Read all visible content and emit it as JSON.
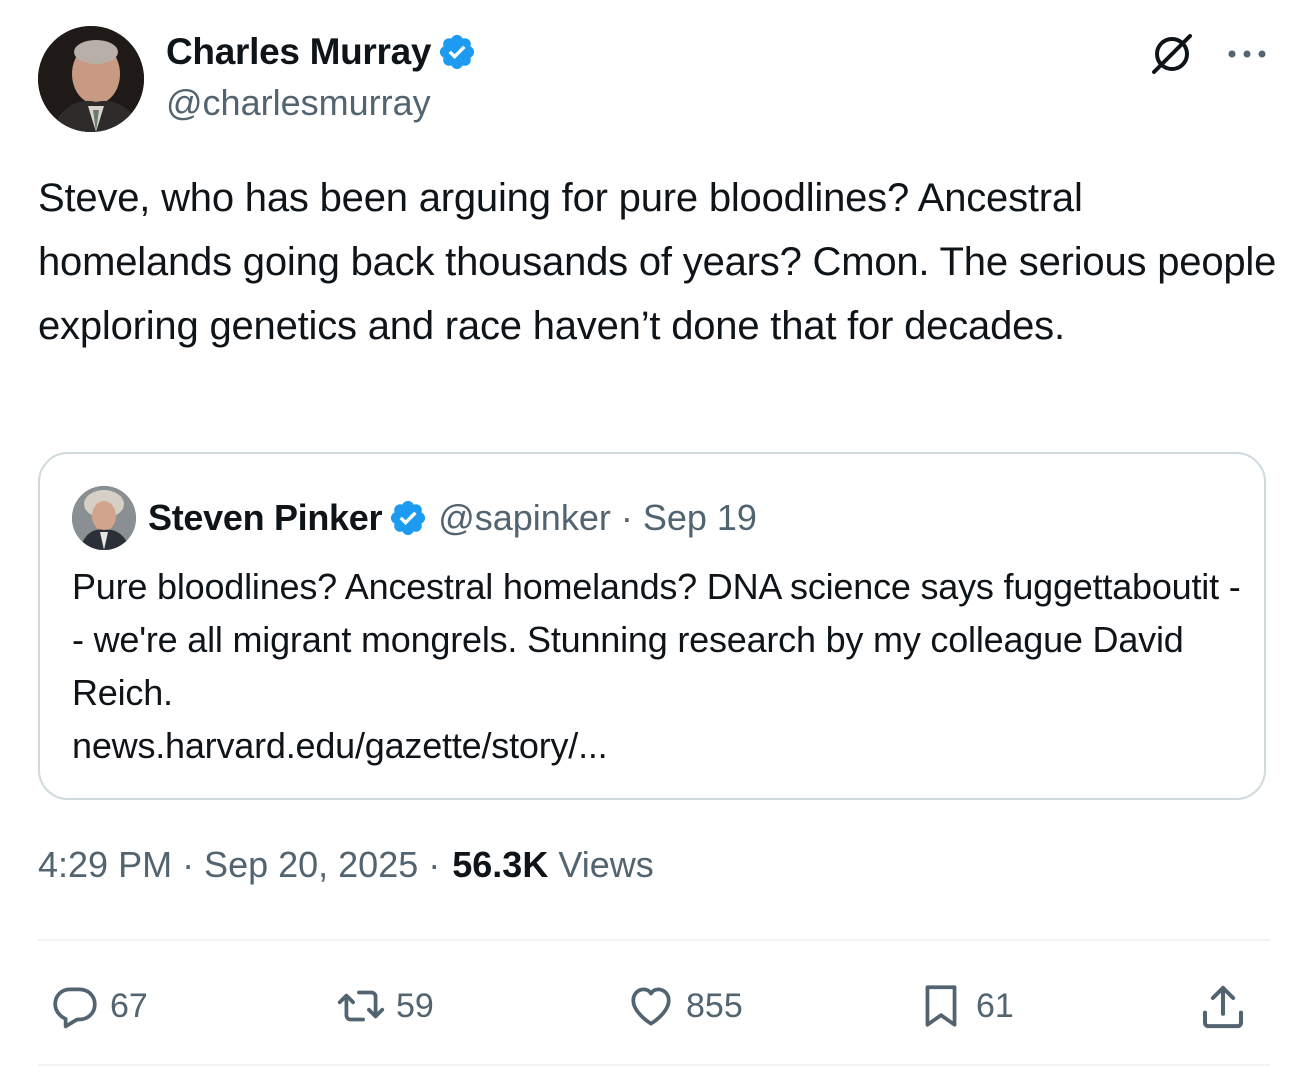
{
  "tweet": {
    "author": {
      "name": "Charles Murray",
      "handle": "@charlesmurray"
    },
    "text": "Steve, who has been arguing for pure bloodlines? Ancestral homelands going back thousands of years? Cmon. The serious people exploring genetics and race haven’t done that for decades.",
    "timestamp": "4:29 PM · Sep 20, 2025 ·",
    "views_count": "56.3K",
    "views_label": "Views"
  },
  "quoted": {
    "author": {
      "name": "Steven Pinker",
      "handle": "@sapinker"
    },
    "meta": "@sapinker · Sep 19",
    "text": "Pure bloodlines? Ancestral homelands? DNA science says fuggettaboutit -- we're all migrant mongrels. Stunning research by my colleague David Reich.",
    "link": "news.harvard.edu/gazette/story/..."
  },
  "actions": {
    "replies": "67",
    "reposts": "59",
    "likes": "855",
    "bookmarks": "61"
  },
  "colors": {
    "verified": "#1d9bf0",
    "secondary_text": "#536471",
    "border": "#cfd9de",
    "divider": "#eff3f4"
  },
  "icons": [
    "verified-badge-icon",
    "grok-icon",
    "more-icon",
    "reply-icon",
    "repost-icon",
    "like-icon",
    "bookmark-icon",
    "share-icon"
  ]
}
